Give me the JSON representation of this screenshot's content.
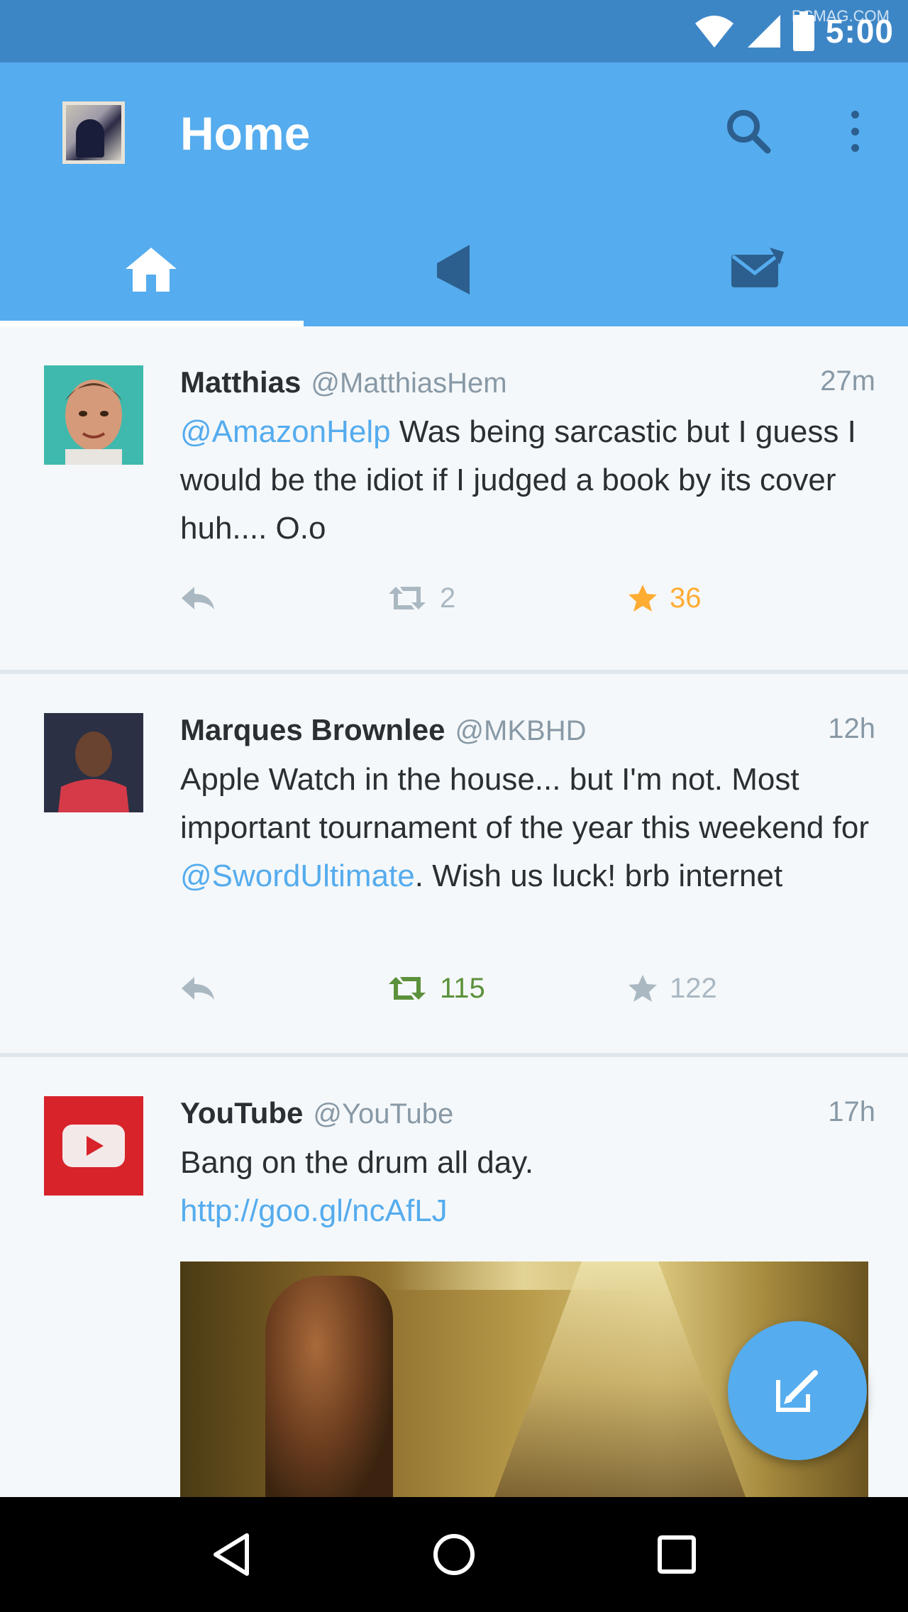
{
  "status_bar": {
    "time": "5:00",
    "watermark": "PCMAG.COM"
  },
  "app_bar": {
    "title": "Home",
    "tabs": [
      {
        "icon": "home-icon",
        "selected": true
      },
      {
        "icon": "notifications-icon",
        "selected": false
      },
      {
        "icon": "messages-icon",
        "selected": false
      }
    ]
  },
  "tweets": [
    {
      "name": "Matthias",
      "handle": "@MatthiasHem",
      "time": "27m",
      "text_mention": "@AmazonHelp",
      "text": " Was being sarcastic but I guess I would be the idiot if I judged a book by its cover huh.... O.o",
      "retweet_count": "2",
      "favorite_count": "36"
    },
    {
      "name": "Marques Brownlee",
      "handle": "@MKBHD",
      "time": "12h",
      "text_before": "Apple Watch in the house... but I'm not. Most important tournament of the year this weekend for ",
      "text_mention": "@SwordUltimate",
      "text_after": ". Wish us luck! brb internet",
      "retweet_count": "115",
      "favorite_count": "122"
    },
    {
      "name": "YouTube",
      "handle": "@YouTube",
      "time": "17h",
      "text": "Bang on the drum all day.",
      "link": "http://goo.gl/ncAfLJ"
    }
  ],
  "colors": {
    "brand": "#55acee",
    "status_bar": "#3d86c6",
    "favorite": "#ffac33",
    "retweet": "#5c913b"
  }
}
